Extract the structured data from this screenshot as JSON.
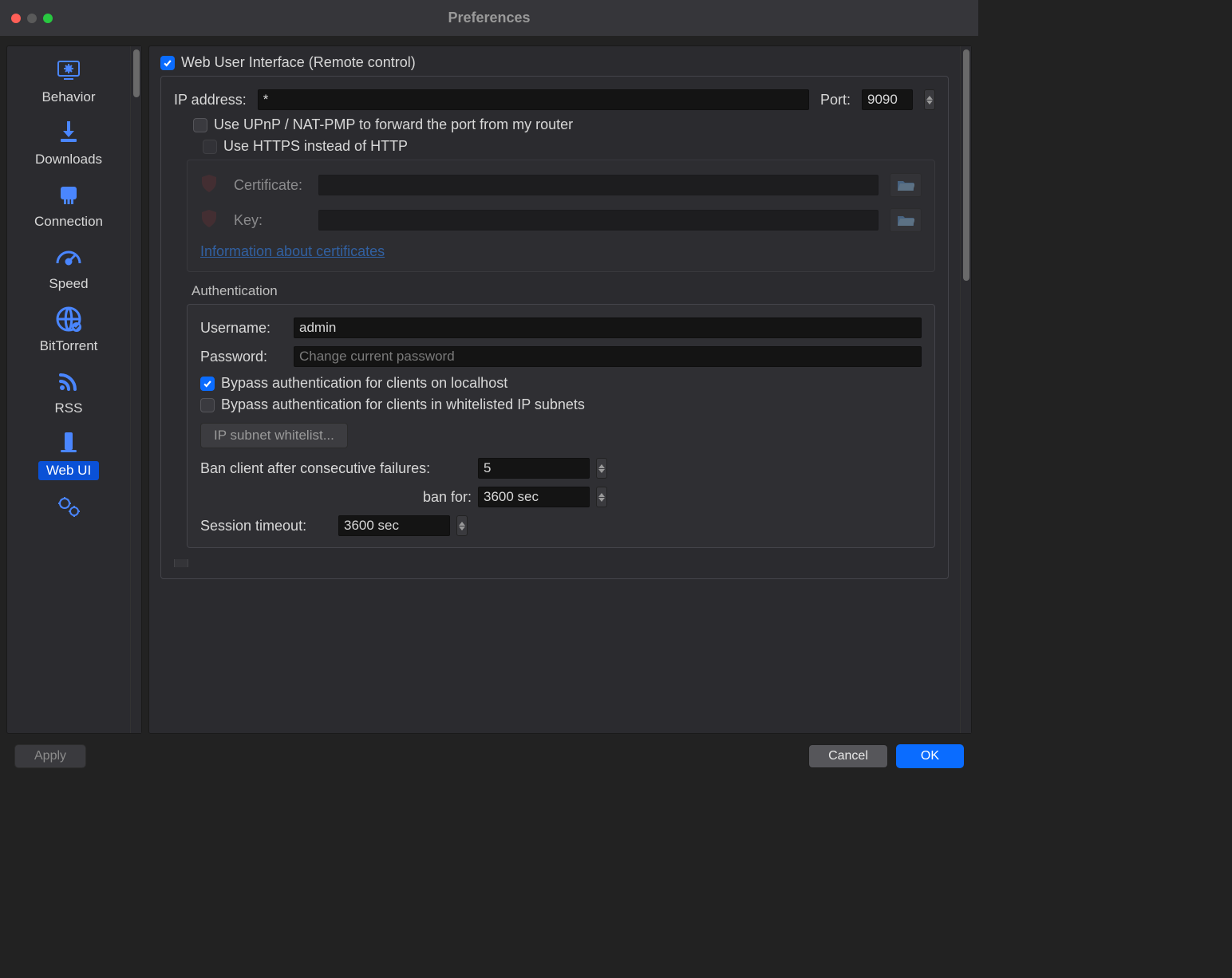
{
  "window": {
    "title": "Preferences"
  },
  "sidebar": {
    "items": [
      {
        "label": "Behavior"
      },
      {
        "label": "Downloads"
      },
      {
        "label": "Connection"
      },
      {
        "label": "Speed"
      },
      {
        "label": "BitTorrent"
      },
      {
        "label": "RSS"
      },
      {
        "label": "Web UI"
      }
    ]
  },
  "main": {
    "enable_label": "Web User Interface (Remote control)",
    "ip_label": "IP address:",
    "ip_value": "*",
    "port_label": "Port:",
    "port_value": "9090",
    "upnp_label": "Use UPnP / NAT-PMP to forward the port from my router",
    "https_label": "Use HTTPS instead of HTTP",
    "cert_label": "Certificate:",
    "key_label": "Key:",
    "cert_value": "",
    "key_value": "",
    "cert_link": "Information about certificates",
    "auth_title": "Authentication",
    "username_label": "Username:",
    "username_value": "admin",
    "password_label": "Password:",
    "password_placeholder": "Change current password",
    "bypass_localhost_label": "Bypass authentication for clients on localhost",
    "bypass_whitelist_label": "Bypass authentication for clients in whitelisted IP subnets",
    "whitelist_button": "IP subnet whitelist...",
    "ban_failures_label": "Ban client after consecutive failures:",
    "ban_failures_value": "5",
    "ban_for_label": "ban for:",
    "ban_for_value": "3600 sec",
    "session_timeout_label": "Session timeout:",
    "session_timeout_value": "3600 sec"
  },
  "footer": {
    "apply": "Apply",
    "cancel": "Cancel",
    "ok": "OK"
  }
}
